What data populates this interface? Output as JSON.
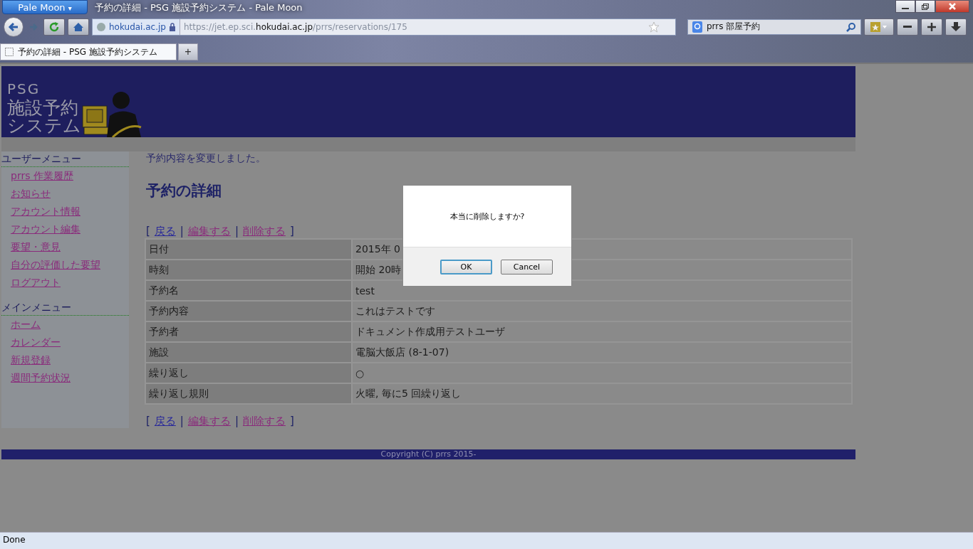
{
  "browser": {
    "menu_button": "Pale Moon",
    "menu_caret": "▾",
    "title": "予約の詳細 - PSG 施設予約システム - Pale Moon",
    "identity": "hokudai.ac.jp",
    "url_prefix": "https://jet.ep.sci.",
    "url_domain": "hokudai.ac.jp",
    "url_path": "/prrs/reservations/175",
    "search_value": "prrs 部屋予約",
    "tabs": [
      {
        "label": "予約の詳細 - PSG 施設予約システム",
        "selected": true
      }
    ],
    "new_tab": "+",
    "status": "Done"
  },
  "page": {
    "logo": [
      "PSG",
      "施設予約",
      "システム"
    ],
    "sidebar": [
      {
        "heading": "ユーザーメニュー",
        "items": [
          {
            "label": "prrs 作業履歴"
          },
          {
            "label": "お知らせ"
          },
          {
            "label": "アカウント情報"
          },
          {
            "label": "アカウント編集"
          },
          {
            "label": "要望・意見"
          },
          {
            "label": "自分の評価した要望"
          },
          {
            "label": "ログアウト"
          }
        ]
      },
      {
        "heading": "メインメニュー",
        "items": [
          {
            "label": "ホーム"
          },
          {
            "label": "カレンダー"
          },
          {
            "label": "新規登録"
          },
          {
            "label": "週間予約状況"
          }
        ]
      }
    ],
    "message": "予約内容を変更しました。",
    "heading": "予約の詳細",
    "actions_top": [
      {
        "kind": "punct",
        "text": "["
      },
      {
        "kind": "link",
        "text": "戻る",
        "visited": false
      },
      {
        "kind": "punct",
        "text": "|"
      },
      {
        "kind": "link",
        "text": "編集する",
        "visited": true
      },
      {
        "kind": "punct",
        "text": "|"
      },
      {
        "kind": "link",
        "text": "削除する",
        "visited": true
      },
      {
        "kind": "punct",
        "text": "]"
      }
    ],
    "details": [
      {
        "label": "日付",
        "value": "2015年 0"
      },
      {
        "label": "時刻",
        "value": "開始 20時"
      },
      {
        "label": "予約名",
        "value": "test"
      },
      {
        "label": "予約内容",
        "value": "これはテストです"
      },
      {
        "label": "予約者",
        "value": "ドキュメント作成用テストユーザ"
      },
      {
        "label": "施設",
        "value": "電脳大飯店 (8-1-07)"
      },
      {
        "label": "繰り返し",
        "value": "○"
      },
      {
        "label": "繰り返し規則",
        "value": "火曜, 毎に5 回繰り返し"
      }
    ],
    "actions_bottom": [
      {
        "kind": "punct",
        "text": "["
      },
      {
        "kind": "link",
        "text": "戻る",
        "visited": false
      },
      {
        "kind": "punct",
        "text": "|"
      },
      {
        "kind": "link",
        "text": "編集する",
        "visited": true
      },
      {
        "kind": "punct",
        "text": "|"
      },
      {
        "kind": "link",
        "text": "削除する",
        "visited": true
      },
      {
        "kind": "punct",
        "text": "]"
      }
    ],
    "footer": "Copyright (C) prrs 2015-"
  },
  "dialog": {
    "message": "本当に削除しますか?",
    "buttons": [
      {
        "label": "OK",
        "selected": true
      },
      {
        "label": "Cancel",
        "selected": false
      }
    ]
  }
}
